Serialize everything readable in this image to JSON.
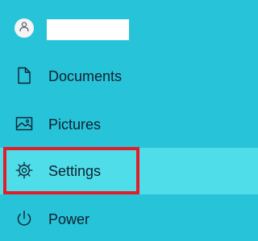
{
  "user": {
    "avatar_icon": "person-icon",
    "name": ""
  },
  "menu": {
    "items": [
      {
        "label": "Documents",
        "icon": "document-icon"
      },
      {
        "label": "Pictures",
        "icon": "pictures-icon"
      },
      {
        "label": "Settings",
        "icon": "gear-icon",
        "selected": true
      },
      {
        "label": "Power",
        "icon": "power-icon"
      }
    ]
  },
  "colors": {
    "panel_background": "#27c3d8",
    "selected_background": "#4fdde9",
    "highlight_border": "#e21d2a",
    "text": "#0f2030"
  }
}
